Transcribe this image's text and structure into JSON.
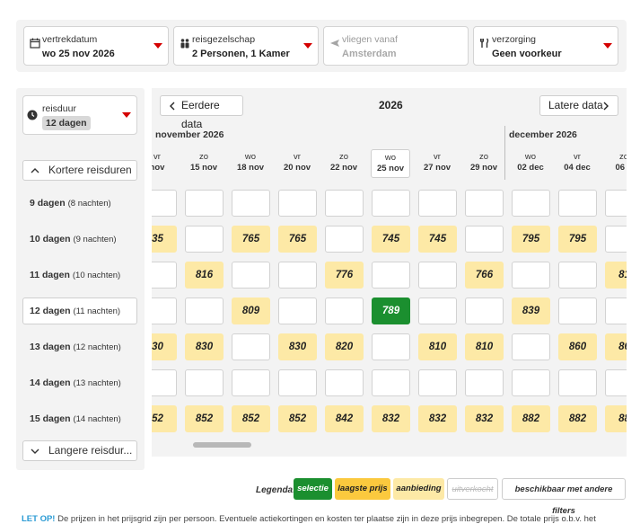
{
  "filters": [
    {
      "label": "vertrekdatum",
      "value": "wo 25 nov 2026",
      "icon": "calendar-icon",
      "disabled": false
    },
    {
      "label": "reisgezelschap",
      "value": "2 Personen, 1 Kamer",
      "icon": "people-icon",
      "disabled": false
    },
    {
      "label": "vliegen vanaf",
      "value": "Amsterdam",
      "icon": "plane-icon",
      "disabled": true
    },
    {
      "label": "verzorging",
      "value": "Geen voorkeur",
      "icon": "cutlery-icon",
      "disabled": false
    }
  ],
  "duration": {
    "label": "reisduur",
    "value": "12 dagen"
  },
  "shorter_label": "Kortere reisduren",
  "longer_label": "Langere reisdur...",
  "rows": [
    {
      "days": "9 dagen",
      "nights": "(8 nachten)"
    },
    {
      "days": "10 dagen",
      "nights": "(9 nachten)"
    },
    {
      "days": "11 dagen",
      "nights": "(10 nachten)"
    },
    {
      "days": "12 dagen",
      "nights": "(11 nachten)"
    },
    {
      "days": "13 dagen",
      "nights": "(12 nachten)"
    },
    {
      "days": "14 dagen",
      "nights": "(13 nachten)"
    },
    {
      "days": "15 dagen",
      "nights": "(14 nachten)"
    }
  ],
  "selected_row": 3,
  "nav": {
    "prev": "Eerdere data",
    "next": "Latere data",
    "year": "2026"
  },
  "months": [
    "november 2026",
    "december 2026"
  ],
  "columns": [
    {
      "dow": "vr",
      "date": "nov"
    },
    {
      "dow": "zo",
      "date": "15 nov"
    },
    {
      "dow": "wo",
      "date": "18 nov"
    },
    {
      "dow": "vr",
      "date": "20 nov"
    },
    {
      "dow": "zo",
      "date": "22 nov"
    },
    {
      "dow": "wo",
      "date": "25 nov"
    },
    {
      "dow": "vr",
      "date": "27 nov"
    },
    {
      "dow": "zo",
      "date": "29 nov"
    },
    {
      "dow": "wo",
      "date": "02 dec"
    },
    {
      "dow": "vr",
      "date": "04 dec"
    },
    {
      "dow": "zo",
      "date": "06 d"
    }
  ],
  "selected_column": 5,
  "prices": [
    [
      "",
      "",
      "",
      "",
      "",
      "",
      "",
      "",
      "",
      "",
      ""
    ],
    [
      "35",
      "",
      "765",
      "765",
      "",
      "745",
      "745",
      "",
      "795",
      "795",
      ""
    ],
    [
      "",
      "816",
      "",
      "",
      "776",
      "",
      "",
      "766",
      "",
      "",
      "81"
    ],
    [
      "",
      "",
      "809",
      "",
      "",
      "789",
      "",
      "",
      "839",
      "",
      ""
    ],
    [
      "30",
      "830",
      "",
      "830",
      "820",
      "",
      "810",
      "810",
      "",
      "860",
      "86"
    ],
    [
      "",
      "",
      "",
      "",
      "",
      "",
      "",
      "",
      "",
      "",
      ""
    ],
    [
      "52",
      "852",
      "852",
      "852",
      "842",
      "832",
      "832",
      "832",
      "882",
      "882",
      "88"
    ]
  ],
  "styles": [
    [
      "e",
      "e",
      "e",
      "e",
      "e",
      "e",
      "e",
      "e",
      "e",
      "e",
      "e"
    ],
    [
      "d",
      "e",
      "d",
      "d",
      "e",
      "d",
      "d",
      "e",
      "d",
      "d",
      "e"
    ],
    [
      "e",
      "d",
      "e",
      "e",
      "d",
      "e",
      "e",
      "d",
      "e",
      "e",
      "d"
    ],
    [
      "e",
      "e",
      "d",
      "e",
      "e",
      "s",
      "e",
      "e",
      "d",
      "e",
      "e"
    ],
    [
      "d",
      "d",
      "e",
      "d",
      "d",
      "e",
      "d",
      "d",
      "e",
      "d",
      "d"
    ],
    [
      "e",
      "e",
      "e",
      "e",
      "e",
      "e",
      "e",
      "e",
      "e",
      "e",
      "e"
    ],
    [
      "d",
      "d",
      "d",
      "d",
      "d",
      "d",
      "d",
      "d",
      "d",
      "d",
      "d"
    ]
  ],
  "legend": {
    "title": "Legenda:",
    "selection": "selectie",
    "lowest": "laagste prijs",
    "offer": "aanbieding",
    "sold_out": "uitverkocht",
    "other_filters": "beschikbaar met andere filters"
  },
  "note": {
    "prefix": "LET OP!",
    "text": "De prijzen in het prijsgrid zijn per persoon. Eventuele actiekortingen en kosten ter plaatse zijn in deze prijs inbegrepen. De totale prijs o.b.v. het"
  },
  "colors": {
    "selection": "#1b8f2f",
    "lowest": "#fbc93e",
    "offer": "#fde9a6",
    "caret": "#d40000"
  }
}
